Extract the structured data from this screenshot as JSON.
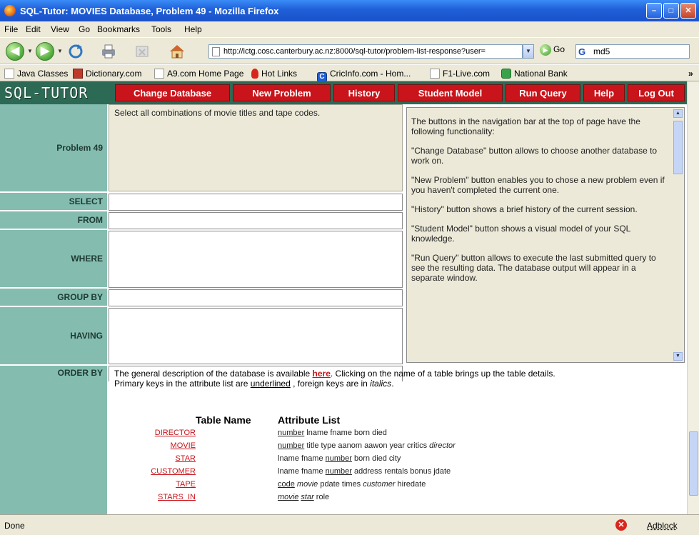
{
  "window": {
    "title": "SQL-Tutor: MOVIES Database, Problem 49 - Mozilla Firefox",
    "min": "–",
    "max": "□",
    "close": "✕"
  },
  "menu": [
    "File",
    "Edit",
    "View",
    "Go",
    "Bookmarks",
    "Tools",
    "Help"
  ],
  "toolbar": {
    "url": "http://ictg.cosc.canterbury.ac.nz:8000/sql-tutor/problem-list-response?user=",
    "go_label": "Go",
    "search_value": "md5",
    "icons": [
      "back-icon",
      "forward-icon",
      "reload-icon",
      "print-icon",
      "stop-icon",
      "home-icon"
    ]
  },
  "bookmarks": [
    "Java Classes",
    "Dictionary.com",
    "A9.com Home Page",
    "Hot Links",
    "CricInfo.com - Hom...",
    "F1-Live.com",
    "National Bank"
  ],
  "tutor": {
    "logo": "SQL-TUTOR",
    "nav": [
      "Change Database",
      "New Problem",
      "History",
      "Student Model",
      "Run Query",
      "Help",
      "Log Out"
    ],
    "problem_label": "Problem 49",
    "problem_text": "Select all combinations of movie titles and tape codes.",
    "clauses": [
      "SELECT",
      "FROM",
      "WHERE",
      "GROUP BY",
      "HAVING",
      "ORDER BY"
    ],
    "help_paragraphs": [
      "The buttons in the navigation bar at the top of page have the following functionality:",
      "\"Change Database\" button allows to choose another database to work on.",
      "\"New Problem\" button enables you to chose a new problem even if you haven't completed the current one.",
      "\"History\" button shows a brief history of the current session.",
      "\"Student Model\" button shows a visual model of your SQL knowledge.",
      "\"Run Query\" button allows to execute the last submitted query to see the resulting data. The database output will appear in a separate window."
    ],
    "desc_part1": "The general description of the database is available ",
    "desc_link": "here",
    "desc_part2": ". Clicking on the name of a table brings up the table details.",
    "desc_part3": "Primary keys in the attribute list are ",
    "desc_underlined": "underlined",
    "desc_part4": " , foreign keys are in ",
    "desc_italics": "italics",
    "desc_part5": ".",
    "table_header": {
      "name": "Table Name",
      "attrs": "Attribute List"
    },
    "tables": [
      {
        "name": "DIRECTOR",
        "attrs": [
          [
            "u",
            "number"
          ],
          [
            "t",
            " lname fname born died"
          ]
        ]
      },
      {
        "name": "MOVIE",
        "attrs": [
          [
            "u",
            "number"
          ],
          [
            "t",
            " title type aanom aawon year critics "
          ],
          [
            "i",
            "director"
          ]
        ]
      },
      {
        "name": "STAR",
        "attrs": [
          [
            "t",
            "lname fname "
          ],
          [
            "u",
            "number"
          ],
          [
            "t",
            " born died city"
          ]
        ]
      },
      {
        "name": "CUSTOMER",
        "attrs": [
          [
            "t",
            "lname fname "
          ],
          [
            "u",
            "number"
          ],
          [
            "t",
            " address rentals bonus jdate"
          ]
        ]
      },
      {
        "name": "TAPE",
        "attrs": [
          [
            "u",
            "code"
          ],
          [
            "t",
            " "
          ],
          [
            "i",
            "movie"
          ],
          [
            "t",
            " pdate times "
          ],
          [
            "i",
            "customer"
          ],
          [
            "t",
            " hiredate"
          ]
        ]
      },
      {
        "name": "STARS_IN",
        "attrs": [
          [
            "ui",
            "movie"
          ],
          [
            "t",
            " "
          ],
          [
            "ui",
            "star"
          ],
          [
            "t",
            " role"
          ]
        ]
      }
    ]
  },
  "status": {
    "text": "Done",
    "adblock": "Adblock"
  }
}
